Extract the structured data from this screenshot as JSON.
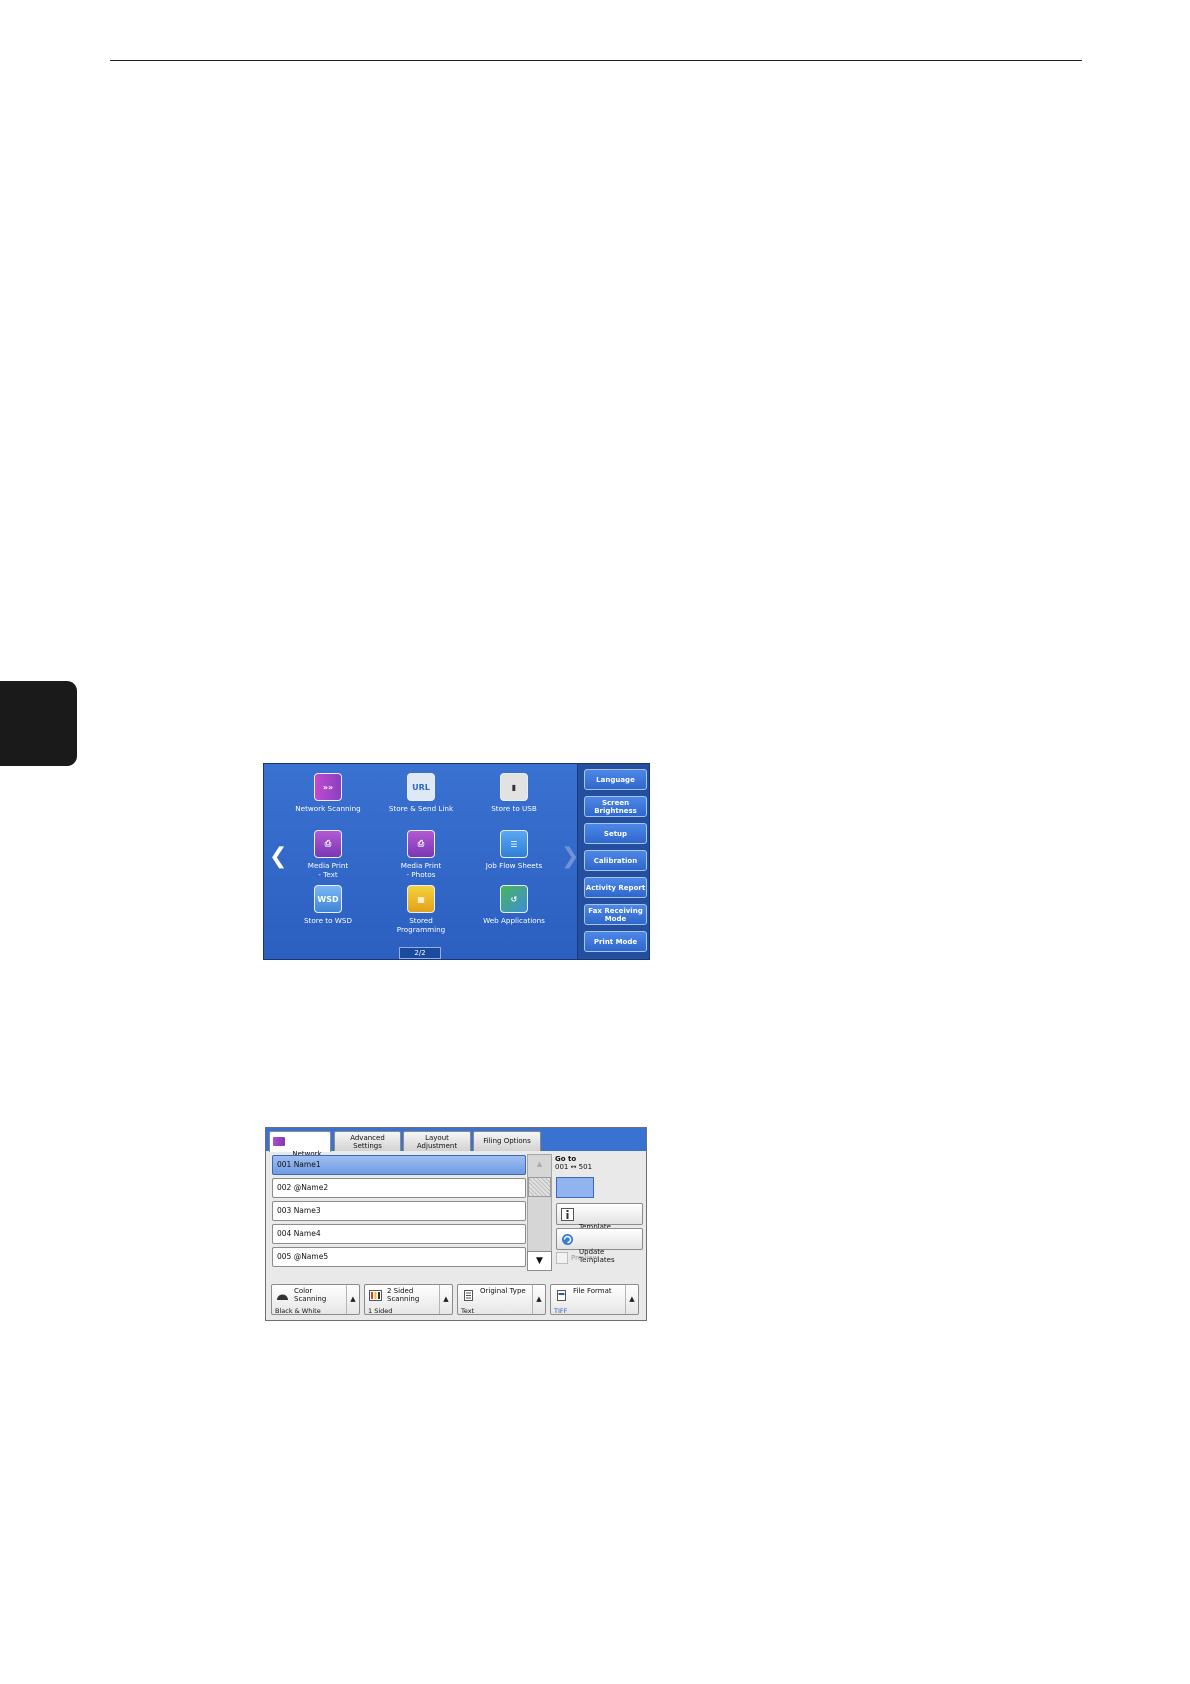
{
  "services_screen": {
    "services": [
      {
        "id": "network-scanning",
        "label": "Network Scanning",
        "icon": "network-scanning-icon"
      },
      {
        "id": "store-send-link",
        "label": "Store & Send Link",
        "icon": "store-send-link-icon",
        "icon_text": "URL"
      },
      {
        "id": "store-to-usb",
        "label": "Store to USB",
        "icon": "usb-icon"
      },
      {
        "id": "media-print-text",
        "label": "Media Print\n- Text",
        "icon": "media-print-text-icon"
      },
      {
        "id": "media-print-photos",
        "label": "Media Print\n- Photos",
        "icon": "media-print-photos-icon"
      },
      {
        "id": "job-flow-sheets",
        "label": "Job Flow Sheets",
        "icon": "job-flow-icon"
      },
      {
        "id": "store-to-wsd",
        "label": "Store to WSD",
        "icon": "wsd-icon",
        "icon_text": "WSD"
      },
      {
        "id": "stored-programming",
        "label": "Stored\nProgramming",
        "icon": "stored-programming-icon"
      },
      {
        "id": "web-applications",
        "label": "Web Applications",
        "icon": "web-applications-icon"
      }
    ],
    "page_indicator": "2/2",
    "side_buttons": [
      "Language",
      "Screen\nBrightness",
      "Setup",
      "Calibration",
      "Activity Report",
      "Fax Receiving\nMode",
      "Print Mode"
    ]
  },
  "scan_screen": {
    "tabs": [
      "Network\nScanning",
      "Advanced\nSettings",
      "Layout\nAdjustment",
      "Filing Options"
    ],
    "templates": [
      "001  Name1",
      "002  @Name2",
      "003  Name3",
      "004  Name4",
      "005  @Name5"
    ],
    "goto_label": "Go to",
    "goto_range": "001 ↔ 501",
    "template_description": "Template\nDescription",
    "update_templates": "Update\nTemplates",
    "preview_label": "Preview",
    "features": [
      {
        "title": "Color\nScanning",
        "value": "Black & White"
      },
      {
        "title": "2 Sided\nScanning",
        "value": "1 Sided"
      },
      {
        "title": "Original Type",
        "value": "Text"
      },
      {
        "title": "File Format",
        "value": "TIFF"
      }
    ]
  }
}
